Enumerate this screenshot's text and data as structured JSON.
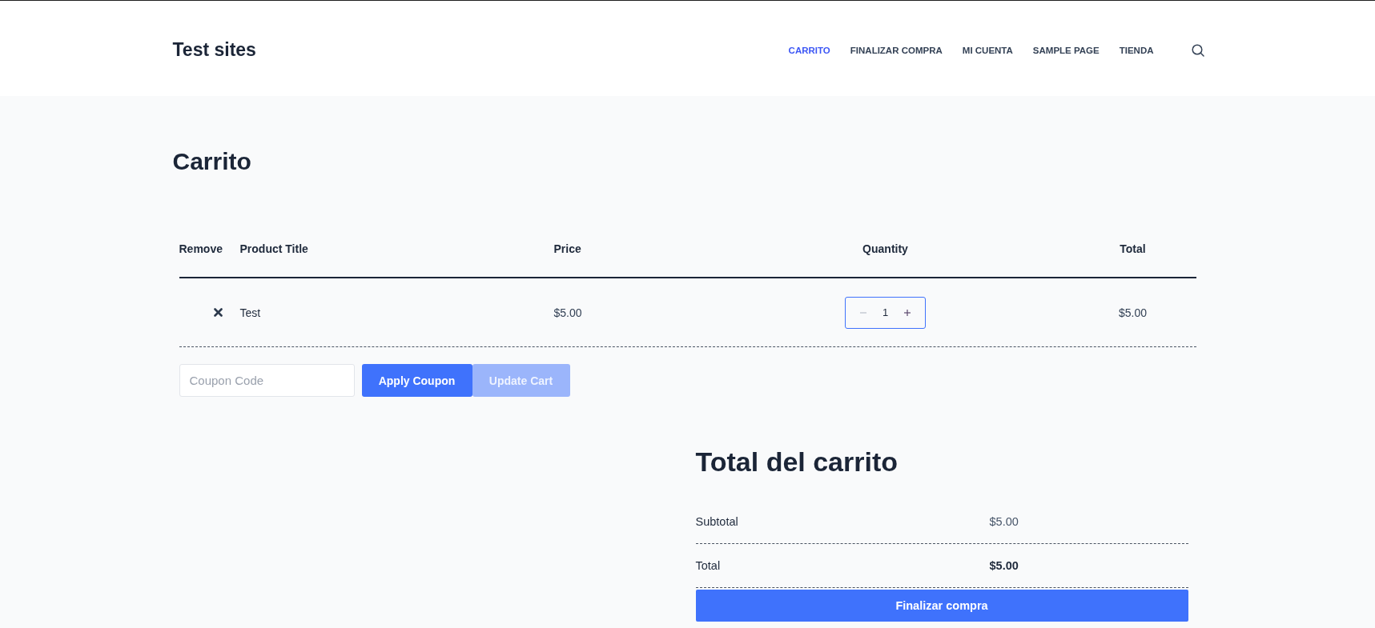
{
  "site": {
    "logo": "Test sites"
  },
  "nav": {
    "items": [
      {
        "label": "CARRITO",
        "selected": true
      },
      {
        "label": "FINALIZAR COMPRA",
        "selected": false
      },
      {
        "label": "MI CUENTA",
        "selected": false
      },
      {
        "label": "SAMPLE PAGE",
        "selected": false
      },
      {
        "label": "TIENDA",
        "selected": false
      }
    ]
  },
  "page_title": "Carrito",
  "cart_table": {
    "columns": [
      "Remove",
      "Product Title",
      "Price",
      "Quantity",
      "Total"
    ],
    "rows": [
      {
        "product": "Test",
        "price": "$5.00",
        "quantity": "1",
        "decrease_disabled": true,
        "total": "$5.00"
      }
    ]
  },
  "coupon": {
    "placeholder": "Coupon Code",
    "apply_button": "Apply Coupon",
    "update_button": {
      "label": "Update Cart",
      "disabled": true
    }
  },
  "cart_totals": {
    "title": "Total del carrito",
    "rows": [
      {
        "kind": "subtotal",
        "label": "Subtotal",
        "value": "$5.00"
      },
      {
        "kind": "total",
        "label": "Total",
        "value": "$5.00"
      }
    ],
    "checkout_button": "Finalizar compra"
  }
}
